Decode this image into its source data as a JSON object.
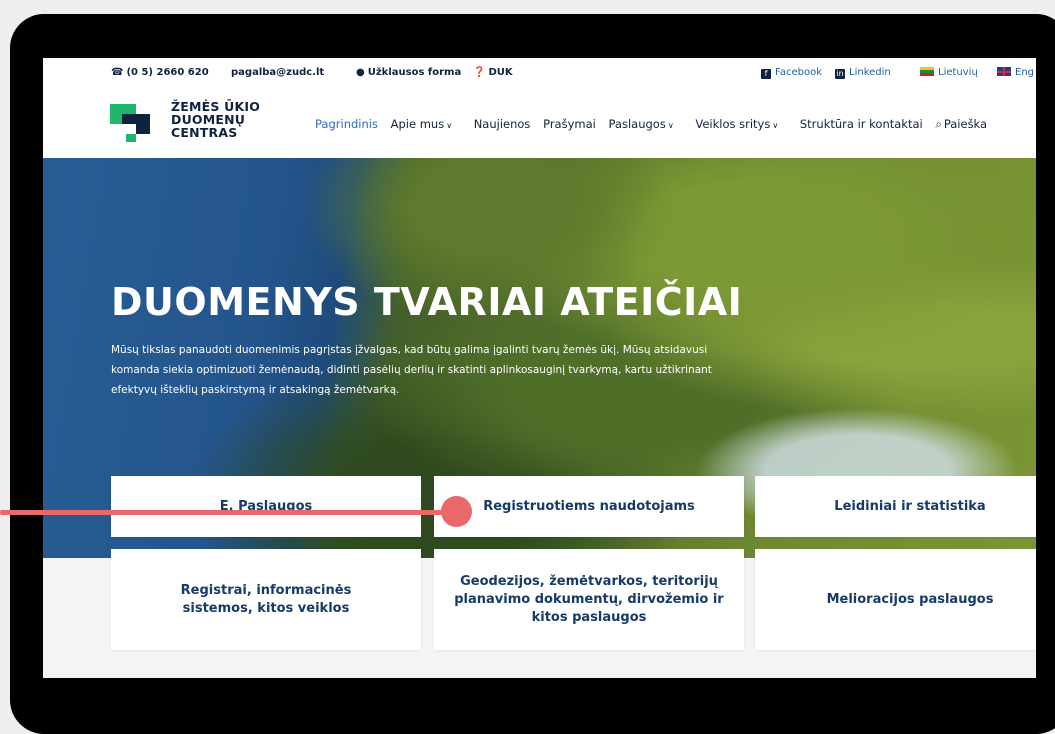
{
  "topbar": {
    "phone": "(0 5) 2660 620",
    "email": "pagalba@zudc.lt",
    "form": "Užklausos forma",
    "faq": "DUK",
    "facebook": "Facebook",
    "linkedin": "Linkedin",
    "lang_lt": "Lietuvių",
    "lang_en": "Eng"
  },
  "logo": {
    "line1": "ŽEMĖS ŪKIO",
    "line2": "DUOMENŲ",
    "line3": "CENTRAS"
  },
  "nav": {
    "items": [
      {
        "label": "Pagrindinis",
        "active": true,
        "dropdown": false
      },
      {
        "label": "Apie mus",
        "active": false,
        "dropdown": true
      },
      {
        "label": "Naujienos",
        "active": false,
        "dropdown": false
      },
      {
        "label": "Prašymai",
        "active": false,
        "dropdown": false
      },
      {
        "label": "Paslaugos",
        "active": false,
        "dropdown": true
      },
      {
        "label": "Veiklos sritys",
        "active": false,
        "dropdown": true
      },
      {
        "label": "Struktūra ir kontaktai",
        "active": false,
        "dropdown": false
      },
      {
        "label": "Paieška",
        "active": false,
        "dropdown": false
      }
    ]
  },
  "hero": {
    "title": "DUOMENYS TVARIAI ATEIČIAI",
    "text": "Mūsų tikslas panaudoti duomenimis pagrįstas įžvalgas, kad būtų galima įgalinti tvarų žemės ūkį. Mūsų atsidavusi komanda siekia optimizuoti žemėnaudą, didinti pasėlių derlių ir skatinti aplinkosauginį tvarkymą, kartu užtikrinant efektyvų išteklių paskirstymą ir atsakingą žemėtvarką."
  },
  "cards": {
    "e_services": "E. Paslaugos",
    "registered_users": "Registruotiems naudotojams",
    "publications": "Leidiniai ir statistika",
    "registers": "Registrai, informacinės sistemos, kitos veiklos",
    "geodesy": "Geodezijos, žemėtvarkos, teritorijų planavimo dokumentų, dirvožemio ir kitos paslaugos",
    "melioration": "Melioracijos paslaugos"
  },
  "colors": {
    "brand_navy": "#0f2341",
    "brand_green": "#1fb86a",
    "link_blue": "#2a6ccf",
    "card_text": "#173a68",
    "pointer": "#e9686a"
  }
}
